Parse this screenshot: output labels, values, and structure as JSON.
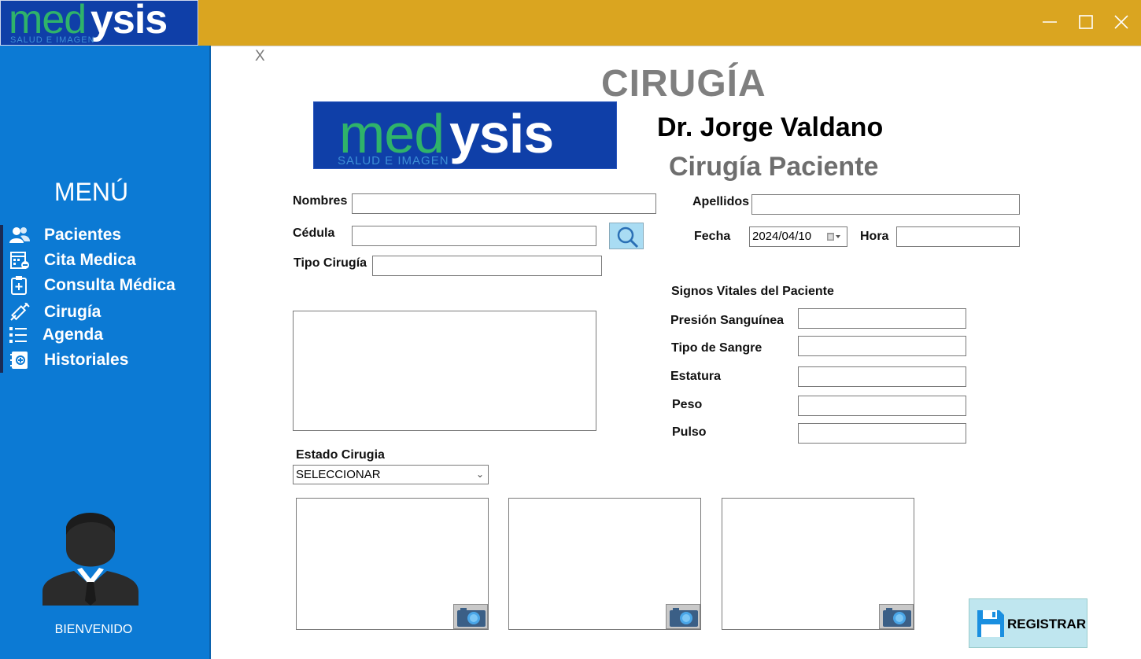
{
  "app": {
    "logo": {
      "word_a": "med",
      "word_b": "ysis",
      "tagline": "SALUD E IMAGEN"
    },
    "window_controls": {
      "minimize": "—",
      "maximize": "☐",
      "close": "✕"
    }
  },
  "colors": {
    "titlebar": "#daa520",
    "sidebar": "#0c7ad4",
    "logo_bg": "#0f3fa8",
    "logo_green": "#2fb36a"
  },
  "sidebar": {
    "title": "MENÚ",
    "items": [
      {
        "label": "Pacientes",
        "icon": "users-icon"
      },
      {
        "label": "Cita Medica",
        "icon": "calendar-icon"
      },
      {
        "label": "Consulta Médica",
        "icon": "clipboard-plus-icon"
      },
      {
        "label": "Cirugía",
        "icon": "syringe-icon"
      },
      {
        "label": "Agenda",
        "icon": "list-icon"
      },
      {
        "label": "Historiales",
        "icon": "notebook-plus-icon"
      }
    ],
    "welcome": "BIENVENIDO"
  },
  "main": {
    "close": "X",
    "title": "CIRUGÍA",
    "doctor": "Dr. Jorge Valdano",
    "subtitle": "Cirugía Paciente",
    "form": {
      "nombres_label": "Nombres",
      "nombres_value": "",
      "apellidos_label": "Apellidos",
      "apellidos_value": "",
      "cedula_label": "Cédula",
      "cedula_value": "",
      "fecha_label": "Fecha",
      "fecha_value": "2024/04/10",
      "hora_label": "Hora",
      "hora_value": "",
      "tipo_label": "Tipo Cirugía",
      "tipo_value": "",
      "estado_label": "Estado Cirugia",
      "estado_value": "SELECCIONAR"
    },
    "vitals": {
      "title": "Signos Vitales del Paciente",
      "presion_label": "Presión Sanguínea",
      "tipo_sangre_label": "Tipo de Sangre",
      "estatura_label": "Estatura",
      "peso_label": "Peso",
      "pulso_label": "Pulso"
    },
    "register_label": "REGISTRAR"
  }
}
